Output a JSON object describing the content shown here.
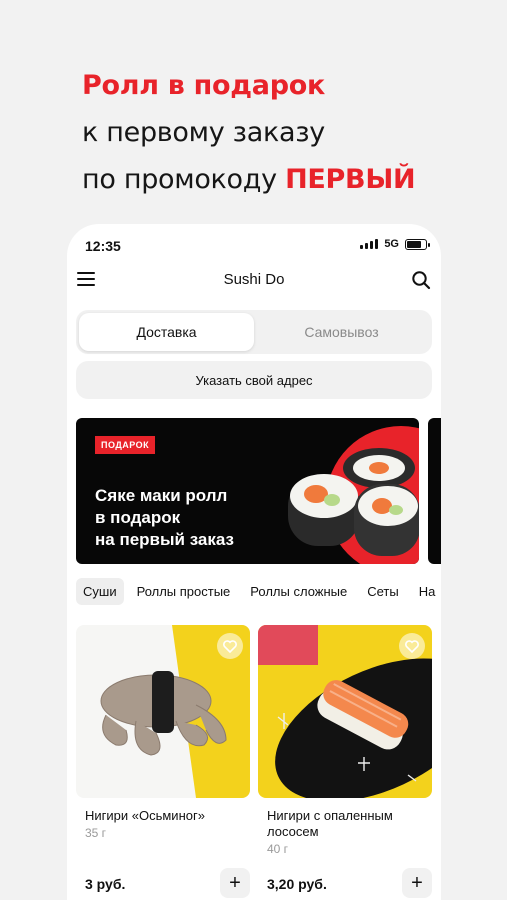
{
  "promo": {
    "line1": "Ролл в подарок",
    "line2": "к первому заказу",
    "line3_prefix": "по промокоду ",
    "line3_code": "ПЕРВЫЙ"
  },
  "status_bar": {
    "time": "12:35",
    "network": "5G"
  },
  "app": {
    "title": "Sushi Do"
  },
  "delivery_toggle": {
    "options": [
      "Доставка",
      "Самовывоз"
    ],
    "selected": "Доставка"
  },
  "address_button": {
    "label": "Указать свой адрес"
  },
  "banner": {
    "badge": "ПОДАРОК",
    "line1": "Сяке маки ролл",
    "line2": "в подарок",
    "line3": "на первый заказ"
  },
  "categories": [
    "Суши",
    "Роллы простые",
    "Роллы сложные",
    "Сеты",
    "На"
  ],
  "selected_category": "Суши",
  "products": [
    {
      "name": "Нигири «Осьминог»",
      "weight": "35 г",
      "price": "3 руб."
    },
    {
      "name": "Нигири с опаленным лососем",
      "weight": "40 г",
      "price": "3,20 руб."
    }
  ],
  "colors": {
    "accent": "#e8232a",
    "banner_bg": "#070707",
    "surface": "#f1f1f1"
  }
}
